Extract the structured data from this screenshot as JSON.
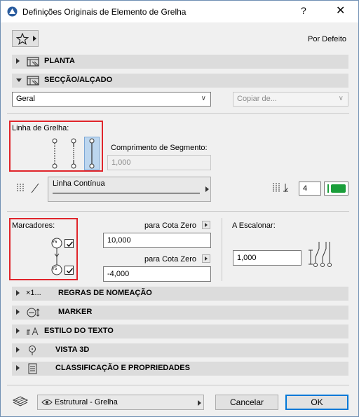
{
  "window": {
    "title": "Definições Originais de Elemento de Grelha",
    "help_glyph": "?",
    "close_glyph": "✕"
  },
  "toolbar": {
    "default_label": "Por Defeito"
  },
  "sections": {
    "planta": "PLANTA",
    "seccao": "SECÇÃO/ALÇADO",
    "regras": "REGRAS DE NOMEAÇÃO",
    "regras_prefix": "×1...",
    "marker": "MARKER",
    "estilo": "ESTILO DO TEXTO",
    "vista3d": "VISTA 3D",
    "classificacao": "CLASSIFICAÇÃO E PROPRIEDADES"
  },
  "seccao": {
    "view_select": "Geral",
    "copy_select": "Copiar de...",
    "grid_line_label": "Linha de Grelha:",
    "segment_label": "Comprimento de Segmento:",
    "segment_value": "1,000",
    "line_type": "Linha Contínua",
    "pen_number": "4",
    "pen_color": "#1a9e3a",
    "markers_label": "Marcadores:",
    "marker_tag": "Y5",
    "cota_zero_label_1": "para Cota Zero",
    "cota_zero_value_1": "10,000",
    "cota_zero_label_2": "para Cota Zero",
    "cota_zero_value_2": "-4,000",
    "stagger_label": "A Escalonar:",
    "stagger_value": "1,000",
    "marker_top_checked": true,
    "marker_bottom_checked": true
  },
  "footer": {
    "layer": "Estrutural - Grelha",
    "cancel": "Cancelar",
    "ok": "OK"
  },
  "colors": {
    "highlight_box": "#e0252b",
    "selected_style_bg": "#bcd6ef"
  }
}
